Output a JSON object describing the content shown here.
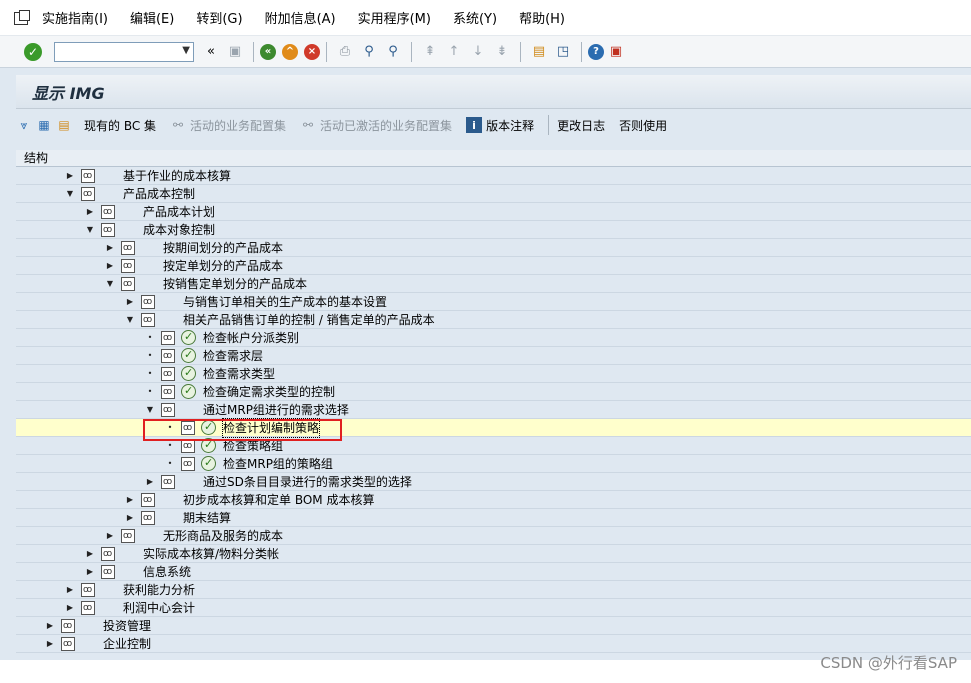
{
  "menu": [
    "实施指南(I)",
    "编辑(E)",
    "转到(G)",
    "附加信息(A)",
    "实用程序(M)",
    "系统(Y)",
    "帮助(H)"
  ],
  "title": "显示 IMG",
  "appbar": {
    "bc_set": "现有的 BC 集",
    "active_config": "活动的业务配置集",
    "activated_config": "活动已激活的业务配置集",
    "release_notes": "版本注释",
    "change_log": "更改日志",
    "used_no": "否则使用"
  },
  "tree": {
    "header": "结构",
    "rows": [
      {
        "level": 1,
        "expand": "▶",
        "exec": false,
        "label": "基于作业的成本核算"
      },
      {
        "level": 1,
        "expand": "▼",
        "exec": false,
        "label": "产品成本控制"
      },
      {
        "level": 2,
        "expand": "▶",
        "exec": false,
        "label": "产品成本计划"
      },
      {
        "level": 2,
        "expand": "▼",
        "exec": false,
        "label": "成本对象控制"
      },
      {
        "level": 3,
        "expand": "▶",
        "exec": false,
        "label": "按期间划分的产品成本"
      },
      {
        "level": 3,
        "expand": "▶",
        "exec": false,
        "label": "按定单划分的产品成本"
      },
      {
        "level": 3,
        "expand": "▼",
        "exec": false,
        "label": "按销售定单划分的产品成本"
      },
      {
        "level": 4,
        "expand": "▶",
        "exec": false,
        "label": "与销售订单相关的生产成本的基本设置"
      },
      {
        "level": 4,
        "expand": "▼",
        "exec": false,
        "label": "相关产品销售订单的控制 / 销售定单的产品成本"
      },
      {
        "level": 5,
        "expand": "•",
        "exec": true,
        "label": "检查帐户分派类别"
      },
      {
        "level": 5,
        "expand": "•",
        "exec": true,
        "label": "检查需求层"
      },
      {
        "level": 5,
        "expand": "•",
        "exec": true,
        "label": "检查需求类型"
      },
      {
        "level": 5,
        "expand": "•",
        "exec": true,
        "label": "检查确定需求类型的控制"
      },
      {
        "level": 5,
        "expand": "▼",
        "exec": false,
        "label": "通过MRP组进行的需求选择"
      },
      {
        "level": 6,
        "expand": "•",
        "exec": true,
        "label": "检查计划编制策略",
        "highlight": true
      },
      {
        "level": 6,
        "expand": "•",
        "exec": true,
        "label": "检查策略组"
      },
      {
        "level": 6,
        "expand": "•",
        "exec": true,
        "label": "检查MRP组的策略组"
      },
      {
        "level": 5,
        "expand": "▶",
        "exec": false,
        "label": "通过SD条目目录进行的需求类型的选择"
      },
      {
        "level": 4,
        "expand": "▶",
        "exec": false,
        "label": "初步成本核算和定单 BOM 成本核算"
      },
      {
        "level": 4,
        "expand": "▶",
        "exec": false,
        "label": "期末结算"
      },
      {
        "level": 3,
        "expand": "▶",
        "exec": false,
        "label": "无形商品及服务的成本"
      },
      {
        "level": 2,
        "expand": "▶",
        "exec": false,
        "label": "实际成本核算/物料分类帐"
      },
      {
        "level": 2,
        "expand": "▶",
        "exec": false,
        "label": "信息系统"
      },
      {
        "level": 1,
        "expand": "▶",
        "exec": false,
        "label": "获利能力分析"
      },
      {
        "level": 1,
        "expand": "▶",
        "exec": false,
        "label": "利润中心会计"
      },
      {
        "level": 0,
        "expand": "▶",
        "exec": false,
        "label": "投资管理"
      },
      {
        "level": 0,
        "expand": "▶",
        "exec": false,
        "label": "企业控制"
      }
    ]
  },
  "watermark": "CSDN @外行看SAP"
}
